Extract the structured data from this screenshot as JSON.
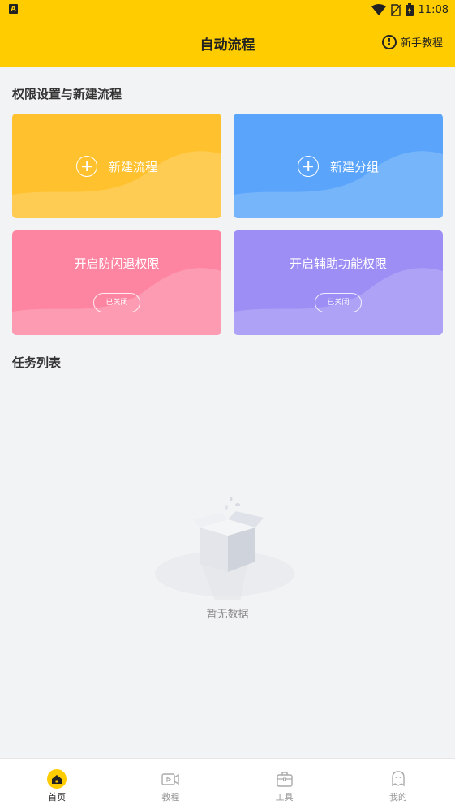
{
  "status_bar": {
    "left_badge": "A",
    "time": "11:08"
  },
  "header": {
    "title": "自动流程",
    "tutorial_label": "新手教程",
    "tutorial_icon": "info-icon",
    "background": "#ffcc00"
  },
  "permissions_section": {
    "title": "权限设置与新建流程",
    "cards": [
      {
        "label": "新建流程",
        "icon": "plus-circle-icon",
        "color": "#ffc12e"
      },
      {
        "label": "新建分组",
        "icon": "plus-circle-icon",
        "color": "#5aa5fb"
      },
      {
        "label": "开启防闪退权限",
        "status": "已关闭",
        "color": "#fd85a2"
      },
      {
        "label": "开启辅助功能权限",
        "status": "已关闭",
        "color": "#9c8ef5"
      }
    ]
  },
  "tasks_section": {
    "title": "任务列表",
    "empty_text": "暂无数据",
    "empty_icon": "empty-box-icon"
  },
  "bottom_nav": {
    "items": [
      {
        "label": "首页",
        "icon": "home-icon",
        "active": true
      },
      {
        "label": "教程",
        "icon": "video-icon",
        "active": false
      },
      {
        "label": "工具",
        "icon": "toolbox-icon",
        "active": false
      },
      {
        "label": "我的",
        "icon": "profile-icon",
        "active": false
      }
    ],
    "active_color": "#ffcc00"
  }
}
